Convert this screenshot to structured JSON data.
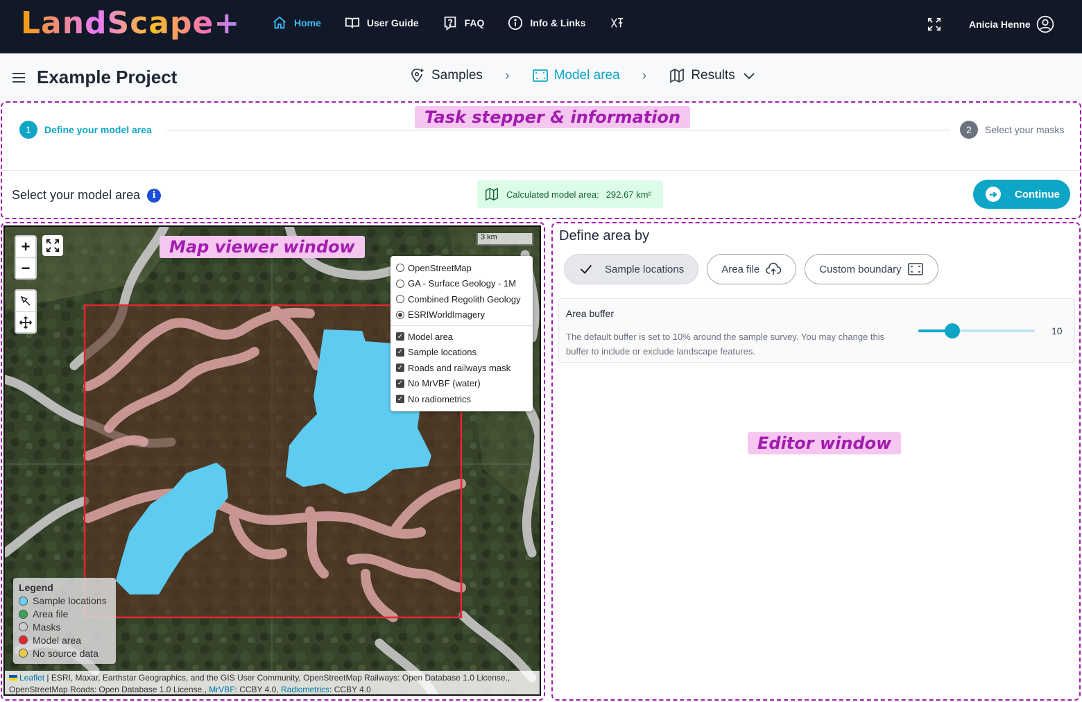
{
  "app": {
    "logo": "LandScape+"
  },
  "nav": {
    "items": [
      {
        "label": "Home",
        "icon": "home-icon",
        "active": true
      },
      {
        "label": "User Guide",
        "icon": "book-icon",
        "active": false
      },
      {
        "label": "FAQ",
        "icon": "question-icon",
        "active": false
      },
      {
        "label": "Info & Links",
        "icon": "info-icon",
        "active": false
      },
      {
        "label": "",
        "icon": "xr-icon",
        "active": false
      }
    ],
    "user_name": "Anicia Henne"
  },
  "project": {
    "title": "Example Project",
    "breadcrumbs": [
      {
        "label": "Samples",
        "icon": "location-pin-icon",
        "active": false
      },
      {
        "label": "Model area",
        "icon": "area-select-icon",
        "active": true
      },
      {
        "label": "Results",
        "icon": "map-icon",
        "active": false,
        "dropdown": true
      }
    ]
  },
  "annotations": {
    "stepper": "Task stepper & information",
    "map": "Map viewer window",
    "editor": "Editor window"
  },
  "stepper": {
    "steps": [
      {
        "number": "1",
        "label": "Define your model area",
        "active": true
      },
      {
        "number": "2",
        "label": "Select your masks",
        "active": false
      }
    ],
    "select_title": "Select your model area",
    "info_glyph": "i",
    "calculated_label": "Calculated model area:",
    "calculated_value": "292.67 km²",
    "continue_label": "Continue"
  },
  "map": {
    "zoom_in": "+",
    "zoom_out": "−",
    "scale": "3 km",
    "base_layers": [
      {
        "label": "OpenStreetMap",
        "selected": false
      },
      {
        "label": "GA - Surface Geology - 1M",
        "selected": false
      },
      {
        "label": "Combined Regolith Geology",
        "selected": false
      },
      {
        "label": "ESRIWorldImagery",
        "selected": true
      }
    ],
    "overlays": [
      {
        "label": "Model area",
        "checked": true
      },
      {
        "label": "Sample locations",
        "checked": true
      },
      {
        "label": "Roads and railways mask",
        "checked": true
      },
      {
        "label": "No MrVBF (water)",
        "checked": true
      },
      {
        "label": "No radiometrics",
        "checked": true
      }
    ],
    "legend": {
      "title": "Legend",
      "items": [
        {
          "label": "Sample locations",
          "color": "#6ecff6"
        },
        {
          "label": "Area file",
          "color": "#3aa655"
        },
        {
          "label": "Masks",
          "color": "#cccccc"
        },
        {
          "label": "Model area",
          "color": "#e5262f"
        },
        {
          "label": "No source data",
          "color": "#e7cc4a"
        }
      ]
    },
    "attribution": {
      "leaflet": "Leaflet",
      "line1": " | ESRI, Maxar, Earthstar Geographics, and the GIS User Community, OpenStreetMap Railways: Open Database 1.0 License.,",
      "line2_a": "OpenStreetMap Roads: Open Database 1.0 License.,",
      "mrvbf": "MrVBF",
      "line2_b": ": CCBY 4.0,",
      "radiometrics": "Radiometrics",
      "line2_c": ": CCBY 4.0"
    },
    "colors": {
      "model_area": "#e5262f",
      "sample_area": "#5ecbf0",
      "mask": "#d9a3a3",
      "road": "#c9c9c9"
    }
  },
  "editor": {
    "title": "Define area by",
    "options": [
      {
        "label": "Sample locations",
        "selected": true,
        "icon": "check-icon"
      },
      {
        "label": "Area file",
        "selected": false,
        "icon": "cloud-upload-icon"
      },
      {
        "label": "Custom boundary",
        "selected": false,
        "icon": "boundary-icon"
      }
    ],
    "buffer": {
      "title": "Area buffer",
      "description": "The default buffer is set to 10% around the sample survey. You may change this buffer to include or exclude landscape features.",
      "value": "10",
      "fraction": 0.29
    }
  }
}
